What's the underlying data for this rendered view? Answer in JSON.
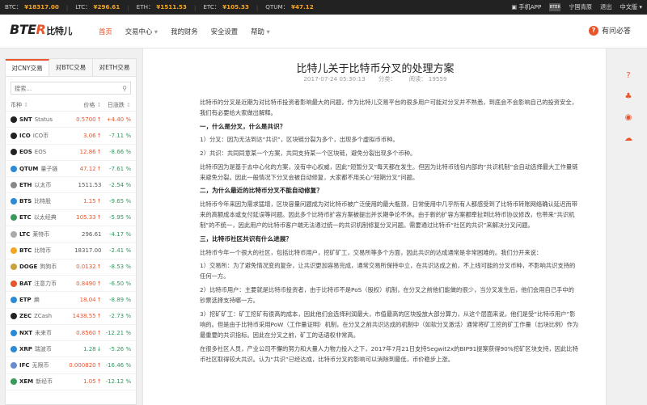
{
  "ticker": [
    {
      "label": "BTC：",
      "value": "¥18317.00"
    },
    {
      "label": "LTC：",
      "value": "¥296.61"
    },
    {
      "label": "ETH：",
      "value": "¥1511.53"
    },
    {
      "label": "ETC：",
      "value": "¥105.33"
    },
    {
      "label": "QTUM：",
      "value": "¥47.12"
    }
  ],
  "topright": {
    "app": "手机APP",
    "qr": "BTER",
    "user": "宁国青原",
    "logout": "退出",
    "lang": "中文版"
  },
  "header": {
    "logo_a": "BTE",
    "logo_r": "R",
    "logo_cn": "比特儿",
    "nav": [
      "首页",
      "交易中心",
      "我的财务",
      "安全设置",
      "帮助"
    ],
    "help_label": "有问必答",
    "help_glyph": "?"
  },
  "sidebar": {
    "tabs": [
      "对CNY交易",
      "对BTC交易",
      "对ETH交易"
    ],
    "search_placeholder": "搜索...",
    "columns": [
      "币种",
      "价格",
      "日涨跌"
    ],
    "coins": [
      {
        "sym": "SNT",
        "name": "Status",
        "price": "0.5700",
        "dir": "up",
        "chg": "+4.40 %",
        "color": "#222"
      },
      {
        "sym": "ICO",
        "name": "ICO币",
        "price": "3.06",
        "dir": "up",
        "chg": "-7.11 %",
        "color": "#222"
      },
      {
        "sym": "EOS",
        "name": "EOS",
        "price": "12.86",
        "dir": "up",
        "chg": "-8.66 %",
        "color": "#222"
      },
      {
        "sym": "QTUM",
        "name": "量子链",
        "price": "47.12",
        "dir": "up",
        "chg": "-7.61 %",
        "color": "#2b8bd6"
      },
      {
        "sym": "ETH",
        "name": "以太币",
        "price": "1511.53",
        "dir": "none",
        "chg": "-2.54 %",
        "color": "#888"
      },
      {
        "sym": "BTS",
        "name": "比特股",
        "price": "1.15",
        "dir": "up",
        "chg": "-9.65 %",
        "color": "#2b8bd6"
      },
      {
        "sym": "ETC",
        "name": "以太经典",
        "price": "105.33",
        "dir": "up",
        "chg": "-5.95 %",
        "color": "#3a9a5a"
      },
      {
        "sym": "LTC",
        "name": "莱特币",
        "price": "296.61",
        "dir": "none",
        "chg": "-4.17 %",
        "color": "#aaa"
      },
      {
        "sym": "BTC",
        "name": "比特币",
        "price": "18317.00",
        "dir": "none",
        "chg": "-2.41 %",
        "color": "#f5a623"
      },
      {
        "sym": "DOGE",
        "name": "狗狗币",
        "price": "0.0132",
        "dir": "up",
        "chg": "-8.53 %",
        "color": "#c9a23a"
      },
      {
        "sym": "BAT",
        "name": "注意力币",
        "price": "0.8490",
        "dir": "up",
        "chg": "-6.50 %",
        "color": "#e8542c"
      },
      {
        "sym": "ETP",
        "name": "熵",
        "price": "18.04",
        "dir": "up",
        "chg": "-8.89 %",
        "color": "#2b8bd6"
      },
      {
        "sym": "ZEC",
        "name": "ZCash",
        "price": "1438.55",
        "dir": "up",
        "chg": "-2.73 %",
        "color": "#222"
      },
      {
        "sym": "NXT",
        "name": "未来币",
        "price": "0.8560",
        "dir": "up",
        "chg": "-12.21 %",
        "color": "#2b8bd6"
      },
      {
        "sym": "XRP",
        "name": "瑞波币",
        "price": "1.28",
        "dir": "down",
        "chg": "-5.26 %",
        "color": "#2b8bd6"
      },
      {
        "sym": "IFC",
        "name": "无限币",
        "price": "0.000820",
        "dir": "up",
        "chg": "-16.46 %",
        "color": "#6a8bd0"
      },
      {
        "sym": "XEM",
        "name": "新经币",
        "price": "1.05",
        "dir": "up",
        "chg": "-12.12 %",
        "color": "#3a9a5a"
      }
    ]
  },
  "article": {
    "title": "比特儿关于比特币分叉的处理方案",
    "date": "2017-07-24 05:30:13",
    "category": "分类：",
    "views_label": "阅读：",
    "views": "19559",
    "paragraphs": [
      {
        "t": "p",
        "text": "比特币的分叉是近期为对比特币投资者影响最大的问题，作为比特儿交易平台的很多用户可能对分叉并不熟悉，到底会不会影响自己的投资安全，我们有必要给大家做出解释。"
      },
      {
        "t": "h",
        "text": "一，什么是分叉，什么是共识？"
      },
      {
        "t": "p",
        "text": "1）分叉：因为无法到达“共识”，区块链分裂为多个，出现多个虚拟币币种。"
      },
      {
        "t": "p",
        "text": "2）共识：共同同意某一个方案，共同支持某一个区块链，避免分裂出现多个币种。"
      },
      {
        "t": "p",
        "text": "比特币因为是基于去中心化的方案，没有中心权威，因此“短暂分叉”每天都在发生。但因为比特币钱包内部的“共识机制”会自动选择最大工作量链来避免分裂。因此一般情况下分叉会被自动修复，大家都不用关心“短期分叉”问题。"
      },
      {
        "t": "h",
        "text": "二，为什么最近的比特币分叉不能自动修复？"
      },
      {
        "t": "p",
        "text": "比特币今年来因为需求猛增，区块容量问题成为对比特币被广泛使用的最大瓶颈，日常使用中几乎所有人都感受到了比特币转账网络确认延迟而带来的高额成本或支付延误等问题。因此多个比特币扩容方案被提出并长期争论不休。由于新的扩容方案都牵扯到比特币协议修改，也带来“共识机制”的不统一，因此用户的比特币客户端无法通过统一的共识机制修复分叉问题。需要通过比特币“社区的共识”来解决分叉问题。"
      },
      {
        "t": "h",
        "text": "三，比特币社区共识有什么进展？"
      },
      {
        "t": "p",
        "text": "比特币今年一个很大的社区，包括比特币用户，挖矿矿工，交易所等多个方面，因此共识的达成通常是非常困难的。我们分开来说："
      },
      {
        "t": "p",
        "text": "1）交易所：为了避免情况变的复杂，让共识更加容易完成，通常交易所保持中立，在共识达成之前，不上线可能的分叉币种，不影响共识支持的任何一方。"
      },
      {
        "t": "p",
        "text": "2）比特币用户：主要就是比特币投资者，由于比特币不是PoS（股权）机制，在分叉之前他们能做的很少，当分叉发生后，他们会用自己手中的钞票选择支持哪一方。"
      },
      {
        "t": "p",
        "text": "3）挖矿矿工：矿工挖矿有很高的成本，因此他们会选择利润最大，市值最高的区块投放大部分算力，从这个层面来说，他们是受“比特币用户”影响的。但是由于比特币采用PoW（工作量证明）机制，在分叉之前共识达成的机制中（如软分叉激活）通常将矿工挖的矿工作量（出块比例）作为最重要的共识指标。因此在分叉之前，矿工的话语权非常高。"
      },
      {
        "t": "p",
        "text": "在很多社区人员，产业公司不懈的努力和大量人力物力投入之下，2017年7月21日支持Segwit2x的BIP91提案获得90%挖矿区块支持，因此比特币社区取得较大共识。认为“共识”已经达成，比特币分叉的影响可以消除到最低，币价稳步上涨。"
      }
    ]
  },
  "float": [
    "?",
    "♣",
    "◉",
    "☁"
  ]
}
